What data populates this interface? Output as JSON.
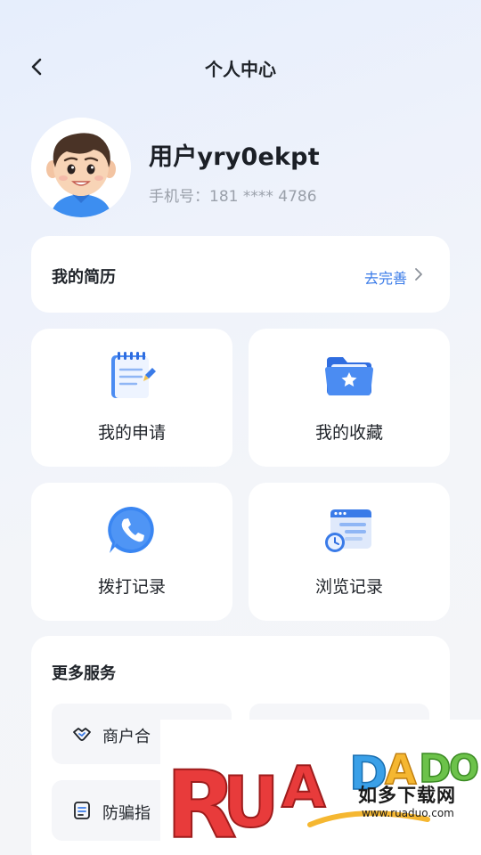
{
  "header": {
    "title": "个人中心",
    "back_icon": "chevron-left-icon"
  },
  "profile": {
    "username": "用户yry0ekpt",
    "phone": "手机号：181 **** 4786",
    "avatar_icon": "cartoon-avatar"
  },
  "resume": {
    "label": "我的简历",
    "action": "去完善",
    "action_color": "#3a7be8"
  },
  "tiles": [
    {
      "label": "我的申请",
      "icon": "notepad-pen-icon"
    },
    {
      "label": "我的收藏",
      "icon": "star-folder-icon"
    },
    {
      "label": "拨打记录",
      "icon": "phone-bubble-icon"
    },
    {
      "label": "浏览记录",
      "icon": "browser-clock-icon"
    }
  ],
  "more_services": {
    "title": "更多服务",
    "items": [
      {
        "label": "商户合",
        "icon": "handshake-icon"
      },
      {
        "label": "",
        "icon": ""
      },
      {
        "label": "防骗指",
        "icon": "document-icon"
      },
      {
        "label": "",
        "icon": ""
      }
    ]
  },
  "watermark": {
    "logo_text": "RUANDUO",
    "cn_text": "如多下载网",
    "url": "www.ruaduo.com"
  }
}
